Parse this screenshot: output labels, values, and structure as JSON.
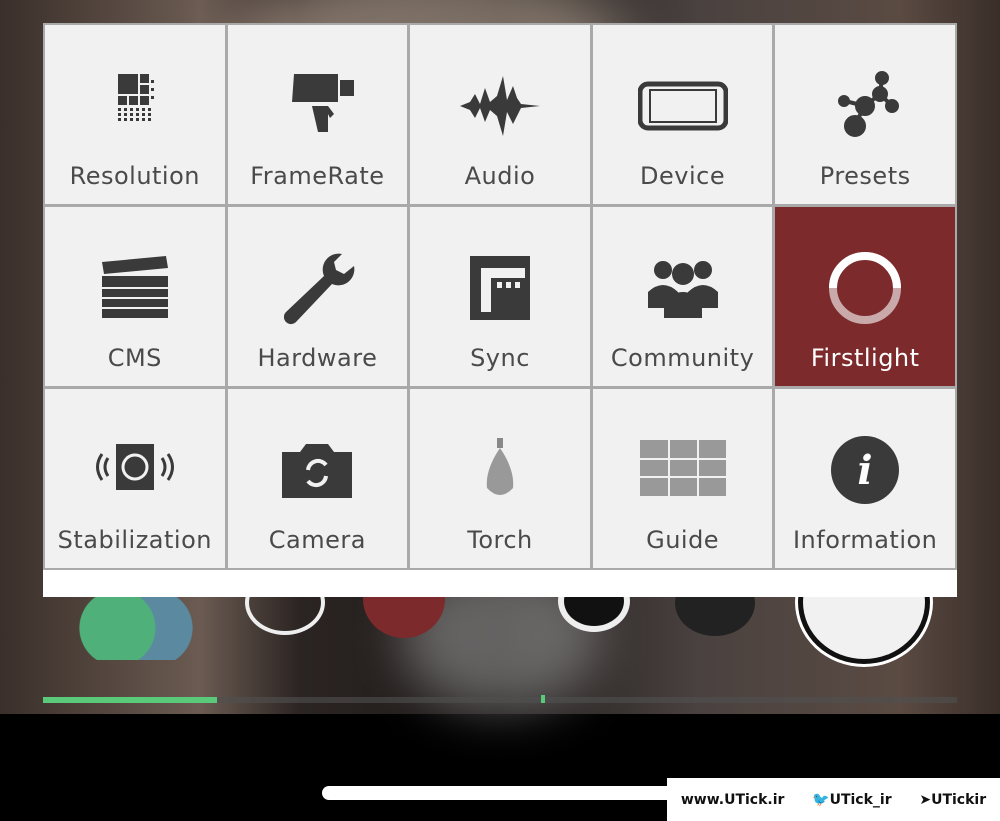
{
  "menu": {
    "items": [
      {
        "label": "Resolution",
        "icon": "resolution-grid-icon"
      },
      {
        "label": "FrameRate",
        "icon": "film-camera-icon"
      },
      {
        "label": "Audio",
        "icon": "audio-waveform-icon"
      },
      {
        "label": "Device",
        "icon": "phone-device-icon"
      },
      {
        "label": "Presets",
        "icon": "presets-molecule-icon"
      },
      {
        "label": "CMS",
        "icon": "clapperboard-icon"
      },
      {
        "label": "Hardware",
        "icon": "wrench-icon"
      },
      {
        "label": "Sync",
        "icon": "sync-icon"
      },
      {
        "label": "Community",
        "icon": "community-people-icon"
      },
      {
        "label": "Firstlight",
        "icon": "firstlight-ring-icon",
        "active": true
      },
      {
        "label": "Stabilization",
        "icon": "stabilization-icon"
      },
      {
        "label": "Camera",
        "icon": "camera-flip-icon"
      },
      {
        "label": "Torch",
        "icon": "torch-bulb-icon"
      },
      {
        "label": "Guide",
        "icon": "guide-grid-icon"
      },
      {
        "label": "Information",
        "icon": "info-icon"
      }
    ],
    "active_color": "#7d2a2c"
  },
  "progress": {
    "fill_percent": 19,
    "color": "#5bc97a"
  },
  "watermark": {
    "site": "www.UTick.ir",
    "twitter": "UTick_ir",
    "telegram": "UTickir"
  }
}
